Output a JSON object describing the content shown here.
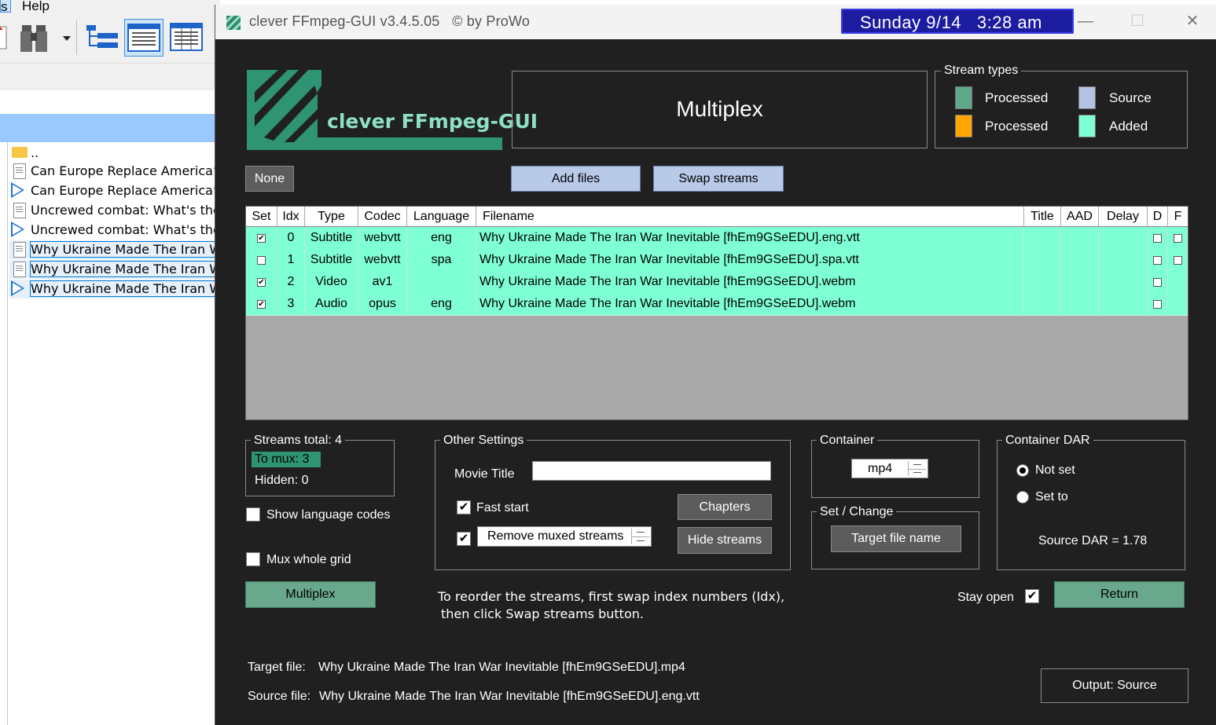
{
  "background_app": {
    "menu": {
      "item_s": "s",
      "help": "Help"
    },
    "files": [
      {
        "icon": "folder-up",
        "name": ".."
      },
      {
        "icon": "document",
        "name": "Can Europe Replace America’s"
      },
      {
        "icon": "video",
        "name": "Can Europe Replace America’s"
      },
      {
        "icon": "document",
        "name": "Uncrewed combat: What's the"
      },
      {
        "icon": "video",
        "name": "Uncrewed combat: What's the"
      },
      {
        "icon": "document",
        "name": "Why Ukraine Made The Iran W"
      },
      {
        "icon": "document",
        "name": "Why Ukraine Made The Iran W"
      },
      {
        "icon": "video",
        "name": "Why Ukraine Made The Iran W"
      }
    ]
  },
  "window": {
    "title": "clever FFmpeg-GUI v3.4.5.05   © by ProWo",
    "clock": "Sunday 9/14   3:28 am",
    "minimize": "—",
    "maximize": "☐",
    "close": "✕"
  },
  "logo": {
    "text": "clever FFmpeg-GUI"
  },
  "header": {
    "title": "Multiplex"
  },
  "stream_types": {
    "title": "Stream types",
    "items": [
      {
        "label": "Processed",
        "color": "#5fa88a"
      },
      {
        "label": "Source",
        "color": "#b4c2e4"
      },
      {
        "label": "Processed",
        "color": "#ffa500"
      },
      {
        "label": "Added",
        "color": "#7fffd4"
      }
    ]
  },
  "toolbar": {
    "none": "None",
    "add_files": "Add files",
    "swap_streams": "Swap streams"
  },
  "grid": {
    "columns": [
      "Set",
      "Idx",
      "Type",
      "Codec",
      "Language",
      "Filename",
      "Title",
      "AAD",
      "Delay",
      "D",
      "F"
    ],
    "rows": [
      {
        "set": true,
        "idx": "0",
        "type": "Subtitle",
        "codec": "webvtt",
        "language": "eng",
        "filename": "Why Ukraine Made The Iran War Inevitable [fhEm9GSeEDU].eng.vtt",
        "title": "",
        "aad": "",
        "delay": "",
        "d": false,
        "f": false
      },
      {
        "set": false,
        "idx": "1",
        "type": "Subtitle",
        "codec": "webvtt",
        "language": "spa",
        "filename": "Why Ukraine Made The Iran War Inevitable [fhEm9GSeEDU].spa.vtt",
        "title": "",
        "aad": "",
        "delay": "",
        "d": false,
        "f": false
      },
      {
        "set": true,
        "idx": "2",
        "type": "Video",
        "codec": "av1",
        "language": "",
        "filename": "Why Ukraine Made The Iran War Inevitable [fhEm9GSeEDU].webm",
        "title": "",
        "aad": "",
        "delay": "",
        "d": false,
        "f": null
      },
      {
        "set": true,
        "idx": "3",
        "type": "Audio",
        "codec": "opus",
        "language": "eng",
        "filename": "Why Ukraine Made The Iran War Inevitable [fhEm9GSeEDU].webm",
        "title": "",
        "aad": "",
        "delay": "",
        "d": false,
        "f": null
      }
    ],
    "row_color": "#7fffd4"
  },
  "streams": {
    "total_label": "Streams total:  4",
    "to_mux": "To mux:  3",
    "hidden": "Hidden:  0"
  },
  "options": {
    "show_language_codes": "Show language codes",
    "mux_whole_grid": "Mux whole grid"
  },
  "multiplex_button": "Multiplex",
  "other_settings": {
    "title": "Other Settings",
    "movie_title_label": "Movie Title",
    "movie_title_value": "",
    "fast_start": "Fast start",
    "remove_muxed": "Remove muxed streams",
    "chapters": "Chapters",
    "hide_streams": "Hide streams"
  },
  "container": {
    "title": "Container",
    "value": "mp4",
    "set_change_title": "Set / Change",
    "target_file_name": "Target file name"
  },
  "dar": {
    "title": "Container DAR",
    "not_set": "Not set",
    "set_to": "Set to",
    "source_dar": "Source DAR = 1.78"
  },
  "hint": {
    "line1": "To reorder the streams, first swap index numbers (Idx),",
    "line2": "then click Swap streams button."
  },
  "stay_open": "Stay open",
  "return_button": "Return",
  "target_file": {
    "label": "Target file:",
    "value": "Why Ukraine Made The Iran War Inevitable [fhEm9GSeEDU].mp4"
  },
  "source_file": {
    "label": "Source file:",
    "value": "Why Ukraine Made The Iran War Inevitable [fhEm9GSeEDU].eng.vtt"
  },
  "output_button": "Output: Source"
}
